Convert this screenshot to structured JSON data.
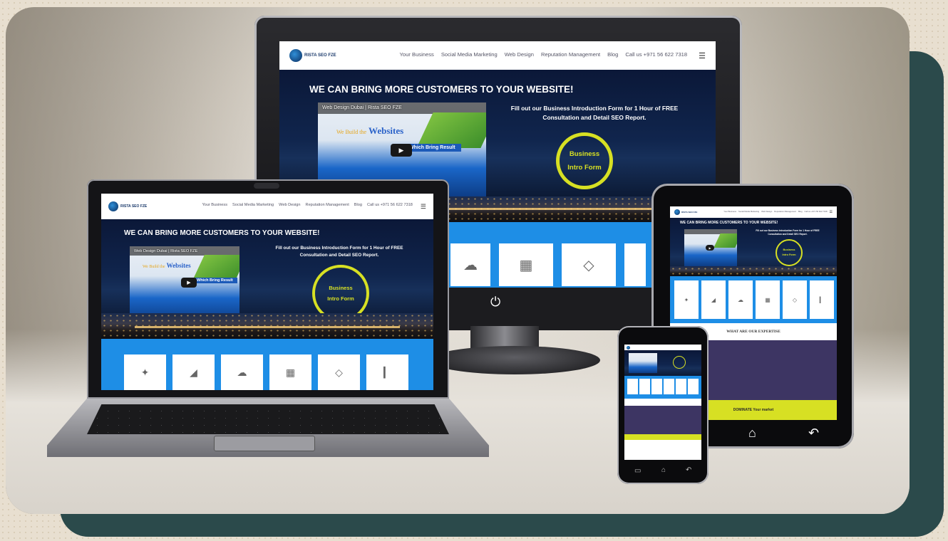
{
  "site": {
    "logo_text": "RISTA SEO FZE",
    "nav": [
      "Your Business",
      "Social Media Marketing",
      "Web Design",
      "Reputation Management",
      "Blog",
      "Call us +971 56 622 7318"
    ],
    "menu_icon": "hamburger-icon",
    "headline": "WE CAN BRING MORE CUSTOMERS TO YOUR WEBSITE!",
    "video": {
      "title": "Web Design Dubai | Rista SEO FZE",
      "tagline_prefix": "We Build the",
      "tagline_main": "Websites",
      "ribbon": "Which Bring Result",
      "play_icon": "play-icon"
    },
    "form_text": "Fill out our Business Introduction Form for 1 Hour of FREE Consultation and Detail SEO Report.",
    "circle_line1": "Business",
    "circle_line2": "Intro Form",
    "tiles": [
      "vector-pen-icon",
      "ruler-triangle-icon",
      "cloud-icon",
      "layout-grid-icon",
      "diamond-icon",
      "paint-roller-icon"
    ],
    "expertise_title": "WHAT ARE OUR EXPERTISE",
    "dominate": "DOMINATE Your market"
  },
  "devices": {
    "monitor_power_icon": "power-icon",
    "tablet_home_icon": "home-icon",
    "tablet_back_icon": "back-icon"
  },
  "colors": {
    "brand_blue": "#1e8ee6",
    "accent_yellow": "#d7e023",
    "navy": "#0a1633",
    "teal_card": "#2b4a4b"
  }
}
